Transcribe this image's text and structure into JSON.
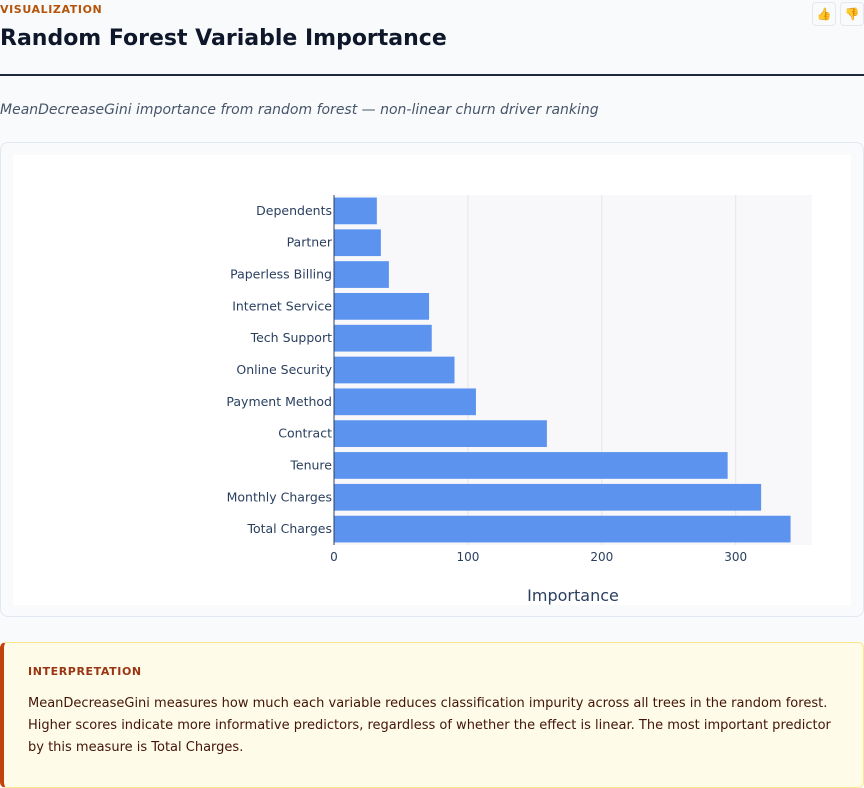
{
  "header": {
    "eyebrow": "VISUALIZATION",
    "title": "Random Forest Variable Importance",
    "subtitle": "MeanDecreaseGini importance from random forest — non-linear churn driver ranking"
  },
  "feedback": {
    "thumbs_up_icon": "thumbs-up-icon",
    "thumbs_down_icon": "thumbs-down-icon"
  },
  "colors": {
    "bar": "#5b93ee",
    "accent": "#c2410c",
    "plot_bg": "#f8f8fa"
  },
  "chart_data": {
    "type": "bar",
    "orientation": "horizontal",
    "categories": [
      "Dependents",
      "Partner",
      "Paperless Billing",
      "Internet Service",
      "Tech Support",
      "Online Security",
      "Payment Method",
      "Contract",
      "Tenure",
      "Monthly Charges",
      "Total Charges"
    ],
    "values": [
      32,
      35,
      41,
      71,
      73,
      90,
      106,
      159,
      294,
      319,
      341
    ],
    "title": "",
    "xlabel": "Importance",
    "ylabel": "",
    "xlim": [
      0,
      357
    ],
    "xticks": [
      0,
      100,
      200,
      300
    ],
    "grid": true
  },
  "interpretation": {
    "label": "INTERPRETATION",
    "text": "MeanDecreaseGini measures how much each variable reduces classification impurity across all trees in the random forest. Higher scores indicate more informative predictors, regardless of whether the effect is linear. The most important predictor by this measure is Total Charges."
  }
}
